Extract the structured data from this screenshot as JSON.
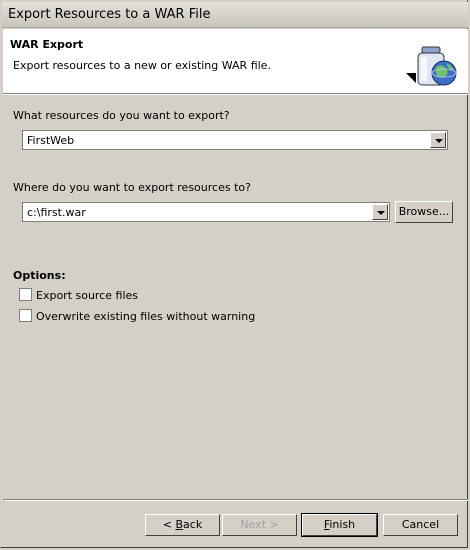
{
  "window": {
    "title": "Export Resources to a WAR File"
  },
  "banner": {
    "title": "WAR Export",
    "description": "Export resources to a new or existing WAR file.",
    "icon": "jar-globe-export-icon"
  },
  "resources": {
    "label": "What resources do you want to export?",
    "value": "FirstWeb"
  },
  "destination": {
    "label": "Where do you want to export resources to?",
    "value": "c:\\first.war",
    "browse_label": "Browse..."
  },
  "options": {
    "heading": "Options:",
    "items": [
      {
        "label": "Export source files",
        "checked": false
      },
      {
        "label": "Overwrite existing files without warning",
        "checked": false
      }
    ]
  },
  "buttons": {
    "back_mnemonic": "B",
    "back_rest": "ack",
    "back_prefix": "< ",
    "next_label": "Next >",
    "finish_mnemonic": "F",
    "finish_rest": "inish",
    "cancel_label": "Cancel"
  }
}
